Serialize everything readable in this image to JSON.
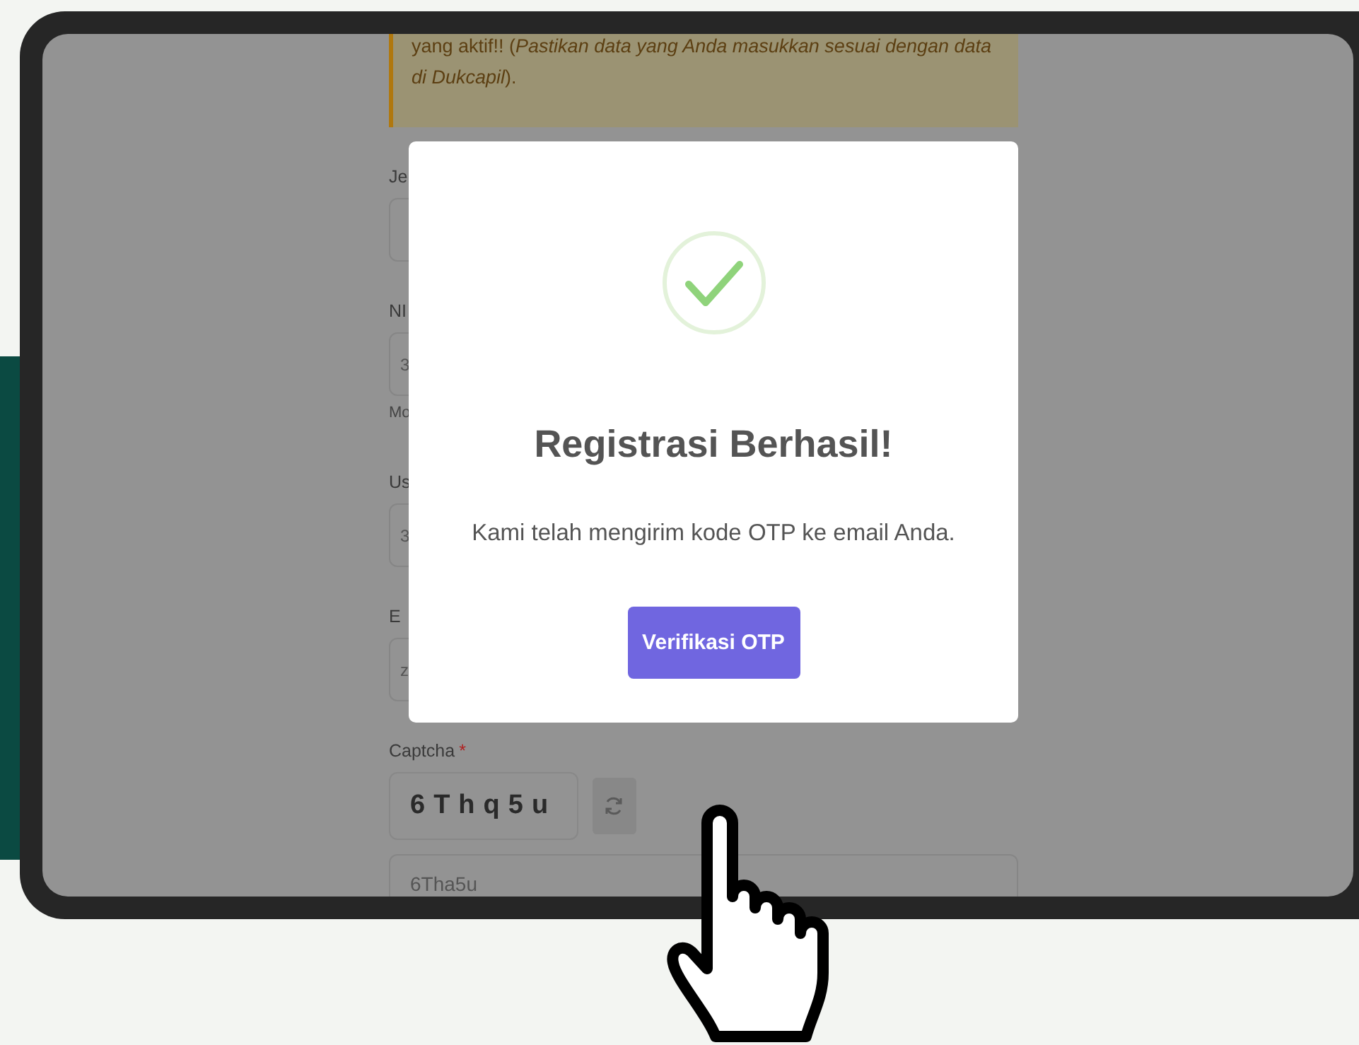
{
  "form": {
    "notice": "yang aktif!! (*Pastikan data yang Anda masukkan sesuai dengan data di Dukcapil*).",
    "fields": [
      {
        "label": "Je"
      },
      {
        "label": "NI",
        "value": "3",
        "hint": "Mo"
      },
      {
        "label": "Us",
        "value": "3"
      },
      {
        "label": "E",
        "value": "z"
      }
    ],
    "captcha": {
      "label": "Captcha",
      "required_mark": "*",
      "code": "6Thq5u",
      "input_value": "6Tha5u"
    }
  },
  "modal": {
    "title": "Registrasi Berhasil!",
    "message": "Kami telah mengirim kode OTP ke email Anda.",
    "button": "Verifikasi OTP"
  }
}
